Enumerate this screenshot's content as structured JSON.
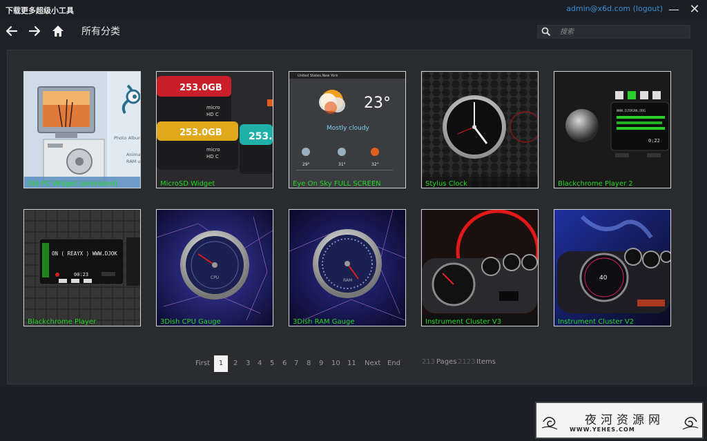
{
  "window": {
    "title": "下载更多超级小工具",
    "user_link": "admin@x6d.com (logout)",
    "minimize": "—",
    "close": "✕"
  },
  "nav": {
    "back_icon": "arrow-left-icon",
    "forward_icon": "arrow-right-icon",
    "home_icon": "home-icon",
    "page_title": "所有分类"
  },
  "search": {
    "icon": "search-icon",
    "placeholder": "搜索"
  },
  "tiles": [
    {
      "label": "Old PC Widget (animated)"
    },
    {
      "label": "MicroSD Widget"
    },
    {
      "label": "Eye On Sky FULL SCREEN"
    },
    {
      "label": "Stylus Clock"
    },
    {
      "label": "Blackchrome Player 2"
    },
    {
      "label": "Blackchrome Player"
    },
    {
      "label": "3Dish CPU Gauge"
    },
    {
      "label": "3Dish RAM Gauge"
    },
    {
      "label": "Instrument Cluster V3"
    },
    {
      "label": "Instrument Cluster V2"
    }
  ],
  "tile_art": {
    "oldpc_small_1": "Photo Album",
    "oldpc_small_2": "Animat",
    "oldpc_small_3": "RAM u",
    "sd_top": "253.0GB",
    "sd_mid": "253.0GB",
    "sd_right": "253.",
    "weather_city": "United States,New York",
    "weather_temp": "23°",
    "weather_cond": "Mostly cloudy",
    "weather_d1": "29°",
    "weather_d2": "31°",
    "weather_d3": "32°",
    "player2_time": "0:22",
    "player2_site": "WWW.DJOKAN.ORG",
    "player_text": "ON ( REAYX ) WWW.DJOK",
    "player_time": "00:23",
    "cpu_label": "CPU",
    "ram_label": "RAM",
    "cluster2_speed": "40"
  },
  "pagination": {
    "first": "First",
    "current": "1",
    "pages": [
      "2",
      "3",
      "4",
      "5",
      "6",
      "7",
      "8",
      "9",
      "10",
      "11"
    ],
    "next": "Next",
    "end": "End",
    "page_count": "213",
    "pages_label": "Pages",
    "item_count": "2123",
    "items_label": "Items"
  },
  "watermark": {
    "title": "夜河资源网",
    "url": "WWW.YEHES.COM"
  },
  "colors": {
    "label_green": "#22d822",
    "link_blue": "#3d8fd6",
    "background": "#1e2128",
    "panel": "#2b2c2f"
  }
}
